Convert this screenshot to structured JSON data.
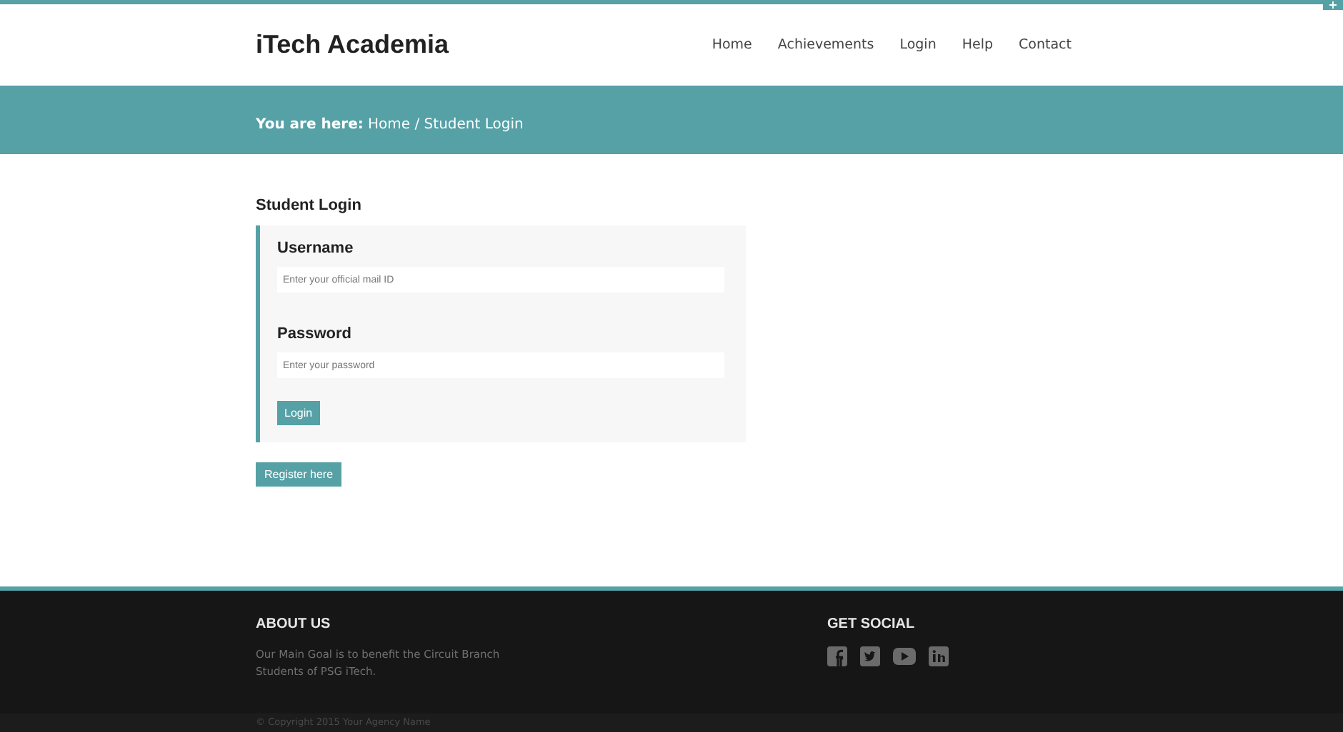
{
  "corner_tab": "+",
  "header": {
    "logo": "iTech Academia",
    "nav": [
      "Home",
      "Achievements",
      "Login",
      "Help",
      "Contact"
    ]
  },
  "breadcrumb": "**You are here:** Home / Student Login",
  "login": {
    "title": "Student Login",
    "fields": [
      {
        "label": "Username",
        "placeholder": "Enter your official mail ID"
      },
      {
        "label": "Password",
        "placeholder": "Enter your password"
      }
    ],
    "submit": "Login",
    "register": "Register here"
  },
  "footer": {
    "about_title": "ABOUT US",
    "about_text": "Our Main Goal is to benefit the Circuit Branch Students of PSG iTech.",
    "social_title": "GET SOCIAL",
    "social": [
      {
        "kind": "facebook"
      },
      {
        "kind": "twitter"
      },
      {
        "kind": "youtube"
      },
      {
        "kind": "linkedin"
      }
    ],
    "copyright": "© Copyright 2015 Your Agency Name"
  }
}
